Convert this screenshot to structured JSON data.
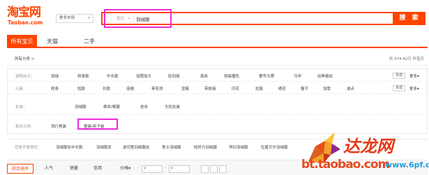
{
  "header": {
    "logo_main": "淘宝网",
    "logo_sub": "Taobao.com",
    "more_market": "更多市场",
    "search_type": "宝贝",
    "search_query": "羽绒服",
    "search_button": "搜 索"
  },
  "tabs": [
    {
      "label": "所有宝贝",
      "active": true
    },
    {
      "label": "天猫",
      "active": false
    },
    {
      "label": "二手",
      "active": false
    }
  ],
  "breadcrumb": "所有分类 >",
  "result_count": "共 374.42万 件宝贝",
  "filters": {
    "hot": {
      "label": "选购热点：",
      "items": [
        "加绒",
        "修身款",
        "中长款",
        "加肥加大",
        "轻羽绒",
        "真丝",
        "拼接撞色",
        "奢华大牌",
        "马甲",
        "经典格纹"
      ],
      "multi": "多选",
      "more": "更多"
    },
    "element": {
      "label": "元素：",
      "items": [
        "修身",
        "短款",
        "长款",
        "连帽",
        "带毛领",
        "显瘦",
        "带拼接",
        "印花",
        "拉链",
        "绣花",
        "帽子",
        "加厚",
        "波点"
      ],
      "multi": "多选",
      "more": "更多"
    },
    "womens": {
      "label": "女装：",
      "items": [
        "羽绒服",
        "棉衣/棉服",
        "皮衣",
        "大码女装"
      ]
    },
    "category": {
      "label": "相关分类：",
      "items": [
        "流行男装",
        "童装/亲子装"
      ]
    }
  },
  "related": {
    "label": "您是不是想找：",
    "items": [
      "羽绒服女中长款",
      "羽绒服女",
      "波司登羽绒服女",
      "男士羽绒服",
      "短时力羽绒服",
      "孕妇羽绒服",
      "拉夏贝尔羽绒服"
    ]
  },
  "sort_bar": {
    "items": [
      "综合排序",
      "人气",
      "销量",
      "信用",
      "价格"
    ],
    "price_from": "¥",
    "price_to": "¥",
    "dash": "-"
  },
  "watermark": {
    "brand_cn": "达龙网",
    "site_text": "bt.taobao.com",
    "url": "www.6pf.cn"
  },
  "colors": {
    "brand_orange": "#ff4400",
    "highlight_magenta": "#ee2bd8"
  }
}
